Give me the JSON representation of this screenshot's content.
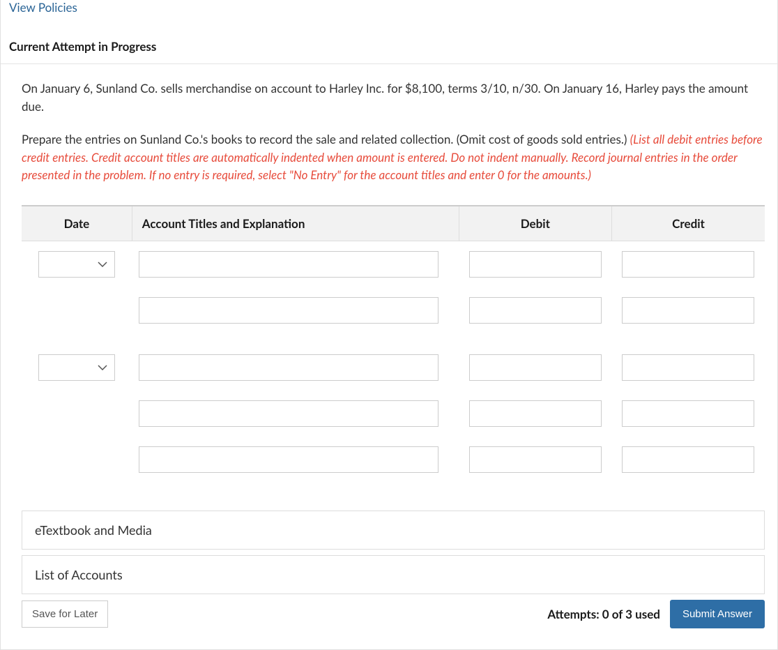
{
  "colors": {
    "link": "#2a6496",
    "hint": "#e74c3c",
    "submit_bg": "#2e6ea6"
  },
  "top_link": "View Policies",
  "section_title": "Current Attempt in Progress",
  "prompt": "On January 6, Sunland Co. sells merchandise on account to Harley Inc. for $8,100, terms 3/10, n/30. On January 16, Harley pays the amount due.",
  "prompt2": "Prepare the entries on Sunland Co.'s books to record the sale and related collection. (Omit cost of goods sold entries.) ",
  "hint": "(List all debit entries before credit entries. Credit account titles are automatically indented when amount is entered. Do not indent manually. Record journal entries in the order presented in the problem. If no entry is required, select \"No Entry\" for the account titles and enter 0 for the amounts.)",
  "table": {
    "headers": {
      "date": "Date",
      "account": "Account Titles and Explanation",
      "debit": "Debit",
      "credit": "Credit"
    },
    "rows": [
      {
        "date_select": true,
        "account": "",
        "debit": "",
        "credit": ""
      },
      {
        "date_select": false,
        "account": "",
        "debit": "",
        "credit": ""
      },
      {
        "date_select": true,
        "account": "",
        "debit": "",
        "credit": ""
      },
      {
        "date_select": false,
        "account": "",
        "debit": "",
        "credit": ""
      },
      {
        "date_select": false,
        "account": "",
        "debit": "",
        "credit": ""
      }
    ]
  },
  "resources": {
    "etextbook": "eTextbook and Media",
    "list_accounts": "List of Accounts"
  },
  "buttons": {
    "save": "Save for Later",
    "submit": "Submit Answer"
  },
  "attempts_text": "Attempts: 0 of 3 used"
}
